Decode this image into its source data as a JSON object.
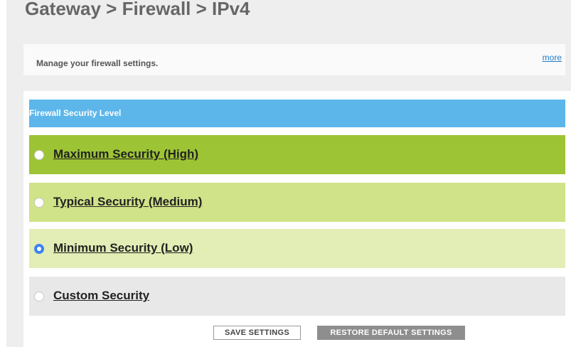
{
  "page": {
    "title": "Gateway > Firewall > IPv4"
  },
  "intro": {
    "text": "Manage your firewall settings.",
    "more_link": "more"
  },
  "security_panel": {
    "header": "Firewall Security Level",
    "selected": "Minimum Security (Low)",
    "options": [
      {
        "label": "Maximum Security (High)",
        "color": "#9dc434",
        "checked": false
      },
      {
        "label": "Typical Security (Medium)",
        "color": "#d0e388",
        "checked": false
      },
      {
        "label": "Minimum Security (Low)",
        "color": "#e2eeb5",
        "checked": true
      },
      {
        "label": "Custom Security",
        "color": "#e8e8e8",
        "checked": false
      }
    ]
  },
  "buttons": {
    "save": "SAVE SETTINGS",
    "restore": "RESTORE DEFAULT SETTINGS"
  },
  "colors": {
    "header_blue": "#5cb6ea",
    "radio_selected": "#3b82f6",
    "link": "#1f7ec6",
    "restore_button": "#8e8e8e"
  }
}
